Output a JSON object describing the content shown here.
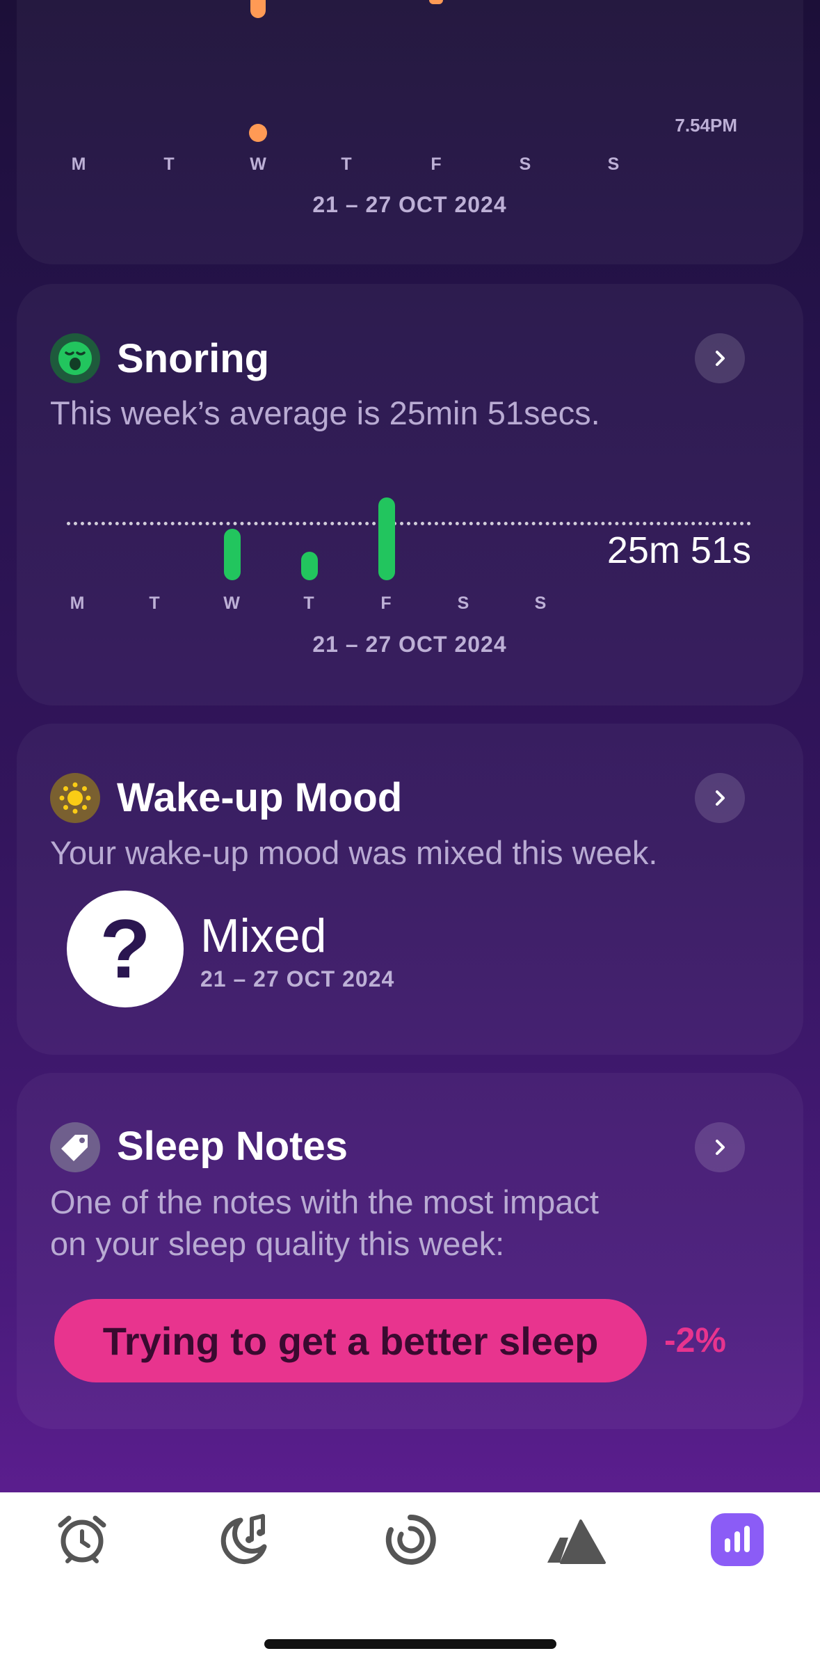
{
  "bedtime_card": {
    "days": [
      "M",
      "T",
      "W",
      "T",
      "F",
      "S",
      "S"
    ],
    "time_label": "7.54PM",
    "date_range": "21 – 27 OCT 2024"
  },
  "snoring_card": {
    "title": "Snoring",
    "subtitle": "This week’s average is 25min 51secs.",
    "average_label": "25m 51s",
    "days": [
      "M",
      "T",
      "W",
      "T",
      "F",
      "S",
      "S"
    ],
    "date_range": "21 – 27 OCT 2024",
    "accent": "#22c55e"
  },
  "mood_card": {
    "title": "Wake-up Mood",
    "subtitle": "Your wake-up mood was mixed this week.",
    "mood_symbol": "?",
    "mood_label": "Mixed",
    "date_range": "21 – 27 OCT 2024"
  },
  "notes_card": {
    "title": "Sleep Notes",
    "subtitle_line1": "One of the notes with the most impact",
    "subtitle_line2": "on your sleep quality this week:",
    "note_label": "Trying to get a better sleep",
    "impact": "-2%",
    "accent": "#e8348e"
  },
  "tabbar": {
    "tabs": [
      {
        "icon": "alarm-clock-icon"
      },
      {
        "icon": "moon-music-icon"
      },
      {
        "icon": "spiral-icon"
      },
      {
        "icon": "mountains-icon"
      },
      {
        "icon": "bar-chart-icon",
        "active": true
      }
    ],
    "active_color": "#8b5cf6"
  },
  "chart_data": [
    {
      "type": "bar",
      "title": "Snoring",
      "categories": [
        "M",
        "T",
        "W",
        "T",
        "F",
        "S",
        "S"
      ],
      "values": [
        0,
        0,
        22,
        13,
        38,
        0,
        0
      ],
      "average_label": "25m 51s",
      "xlabel": "21 – 27 OCT 2024"
    }
  ]
}
